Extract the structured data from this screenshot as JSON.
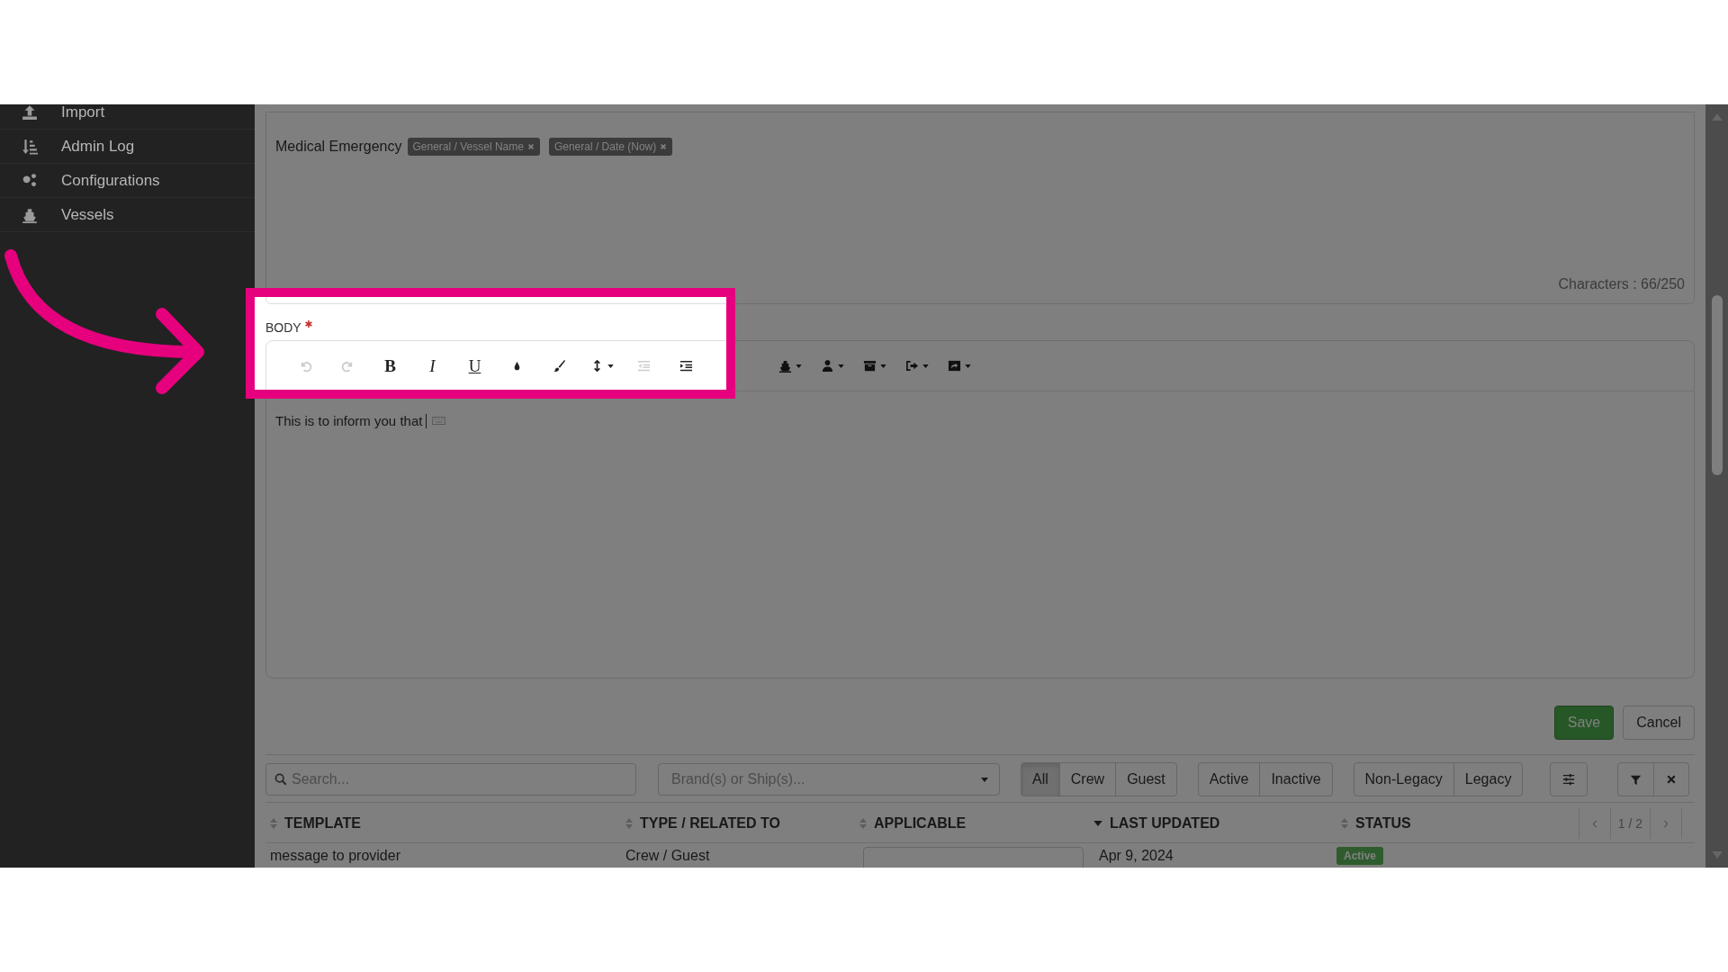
{
  "sidebar": {
    "items": [
      {
        "label": "Import"
      },
      {
        "label": "Admin Log"
      },
      {
        "label": "Configurations"
      },
      {
        "label": "Vessels"
      }
    ]
  },
  "subject": {
    "text": "Medical Emergency",
    "tags": [
      "General / Vessel Name",
      "General / Date (Now)"
    ],
    "counter": "Characters : 66/250"
  },
  "body": {
    "label": "BODY",
    "required": true,
    "toolbar_groups": [
      [
        {
          "kind": "undo",
          "disabled": true
        },
        {
          "kind": "redo",
          "disabled": true
        },
        {
          "kind": "bold",
          "label": "B"
        },
        {
          "kind": "italic",
          "label": "I"
        },
        {
          "kind": "underline",
          "label": "U"
        },
        {
          "kind": "color"
        },
        {
          "kind": "brush"
        },
        {
          "kind": "line-height",
          "dropdown": true
        },
        {
          "kind": "outdent",
          "disabled": true
        },
        {
          "kind": "indent"
        }
      ],
      [
        {
          "kind": "ship",
          "dropdown": true
        },
        {
          "kind": "person",
          "dropdown": true
        },
        {
          "kind": "archive",
          "dropdown": true
        },
        {
          "kind": "sign-out",
          "dropdown": true
        },
        {
          "kind": "share",
          "dropdown": true
        }
      ]
    ],
    "text": "This is to inform you that"
  },
  "actions": [
    {
      "label": "Save",
      "kind": "primary"
    },
    {
      "label": "Cancel",
      "kind": "default"
    }
  ],
  "filters": {
    "search_placeholder": "Search...",
    "select_placeholder": "Brand(s) or Ship(s)...",
    "groups": [
      [
        {
          "label": "All",
          "selected": true
        },
        {
          "label": "Crew",
          "selected": false
        },
        {
          "label": "Guest",
          "selected": false
        }
      ],
      [
        {
          "label": "Active",
          "selected": false
        },
        {
          "label": "Inactive",
          "selected": false
        }
      ],
      [
        {
          "label": "Non-Legacy",
          "selected": false
        },
        {
          "label": "Legacy",
          "selected": false
        }
      ]
    ]
  },
  "table": {
    "columns": [
      {
        "label": "TEMPLATE",
        "sorted": false
      },
      {
        "label": "TYPE / RELATED TO",
        "sorted": false
      },
      {
        "label": "APPLICABLE",
        "sorted": false
      },
      {
        "label": "LAST UPDATED",
        "sorted": true
      },
      {
        "label": "STATUS",
        "sorted": false
      }
    ],
    "pager": "1 / 2",
    "rows": [
      {
        "template": "message to provider",
        "type": "Crew / Guest",
        "last_updated": "Apr 9, 2024",
        "status": "Active"
      }
    ]
  }
}
